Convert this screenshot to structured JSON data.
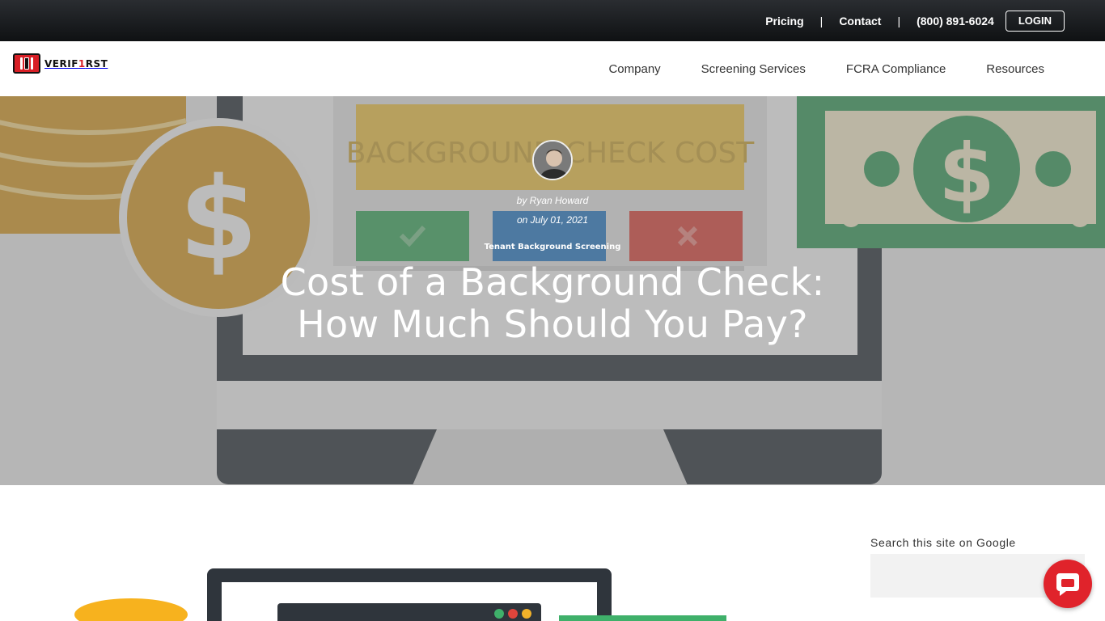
{
  "topbar": {
    "pricing": "Pricing",
    "contact": "Contact",
    "separator": "|",
    "phone": "(800) 891-6024",
    "login": "LOGIN"
  },
  "logo": {
    "text_prefix": "VERIF",
    "text_one": "1",
    "text_suffix": "RST"
  },
  "nav": {
    "items": [
      "Company",
      "Screening Services",
      "FCRA Compliance",
      "Resources"
    ]
  },
  "hero": {
    "image_caption": "BACKGROUND CHECK COST",
    "author": "by Ryan Howard",
    "date": "on July 01, 2021",
    "category": "Tenant Background Screening",
    "title_line1": "Cost of a Background Check:",
    "title_line2": "How Much Should You Pay?"
  },
  "sidebar": {
    "search_label": "Search this site on Google"
  },
  "icons": {
    "chat": "chat-bubble-icon",
    "avatar": "author-avatar"
  },
  "colors": {
    "brand_red": "#d81f26",
    "topbar": "#15171a",
    "chat_red": "#e0232b",
    "coin_gold": "#d39a2a",
    "bill_green": "#3a9a5c"
  }
}
